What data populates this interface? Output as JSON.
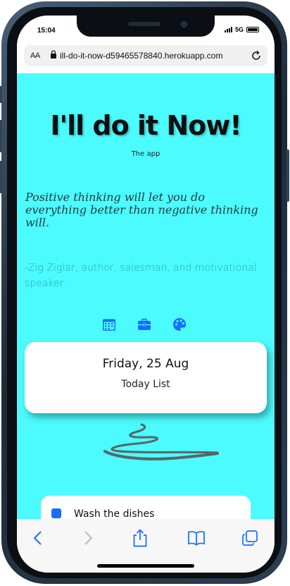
{
  "status": {
    "time": "15:04",
    "network": "5G"
  },
  "browser": {
    "text_size_label": "AA",
    "url": "ill-do-it-now-d59465578840.herokuapp.com"
  },
  "app": {
    "title": "I'll do it Now!",
    "subtitle": "The app",
    "quote": "Positive thinking will let you do everything better than negative thinking will.",
    "author": "-Zig Ziglar, author, salesman, and motivational speaker.",
    "icons": [
      "calendar-icon",
      "briefcase-icon",
      "palette-icon"
    ],
    "date_card": {
      "date": "Friday, 25 Aug",
      "list_name": "Today List"
    },
    "tasks": [
      {
        "label": "Wash the dishes",
        "checked": true
      }
    ]
  },
  "toolbar": {
    "icons": [
      "back-icon",
      "forward-icon",
      "share-icon",
      "bookmarks-icon",
      "tabs-icon"
    ]
  },
  "colors": {
    "background": "#4bfbfd",
    "accent": "#1a6cff",
    "author_text": "#2aa5b8",
    "quote_text": "#1d3b40"
  }
}
